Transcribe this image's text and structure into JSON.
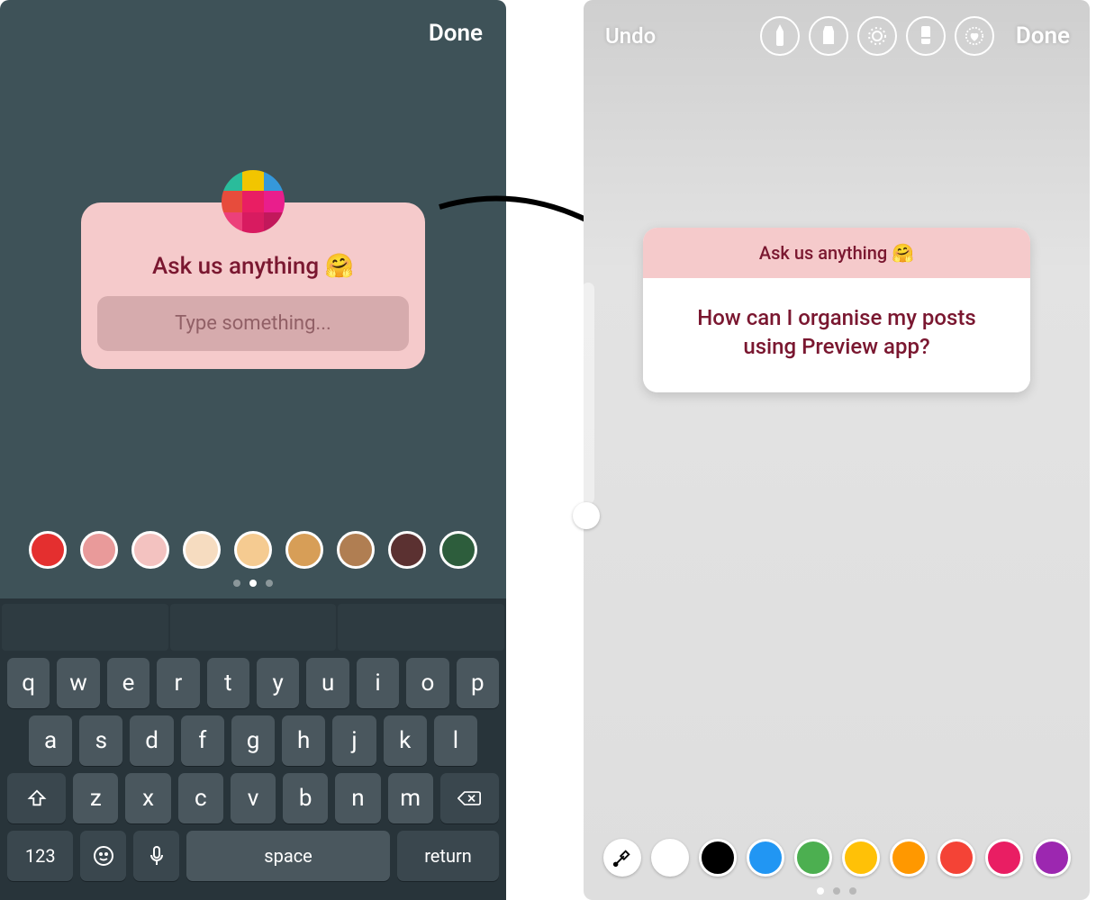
{
  "left": {
    "done_label": "Done",
    "prompt": "Ask us anything 🤗",
    "placeholder": "Type something...",
    "swatches": [
      "#e42f2f",
      "#e99a9a",
      "#f3c2c0",
      "#f6dcc0",
      "#f5cb91",
      "#d79e57",
      "#b07e52",
      "#5b3131",
      "#2d5d3c"
    ],
    "keyboard": {
      "row1": [
        "q",
        "w",
        "e",
        "r",
        "t",
        "y",
        "u",
        "i",
        "o",
        "p"
      ],
      "row2": [
        "a",
        "s",
        "d",
        "f",
        "g",
        "h",
        "j",
        "k",
        "l"
      ],
      "row3": [
        "z",
        "x",
        "c",
        "v",
        "b",
        "n",
        "m"
      ],
      "num_label": "123",
      "space_label": "space",
      "return_label": "return"
    }
  },
  "right": {
    "undo_label": "Undo",
    "done_label": "Done",
    "prompt": "Ask us anything 🤗",
    "answer": "How can I organise my posts using Preview app?",
    "swatches": [
      "#ffffff",
      "#000000",
      "#2196f3",
      "#4caf50",
      "#ffc107",
      "#ff9800",
      "#f44336",
      "#e91e63",
      "#9c27b0"
    ]
  }
}
